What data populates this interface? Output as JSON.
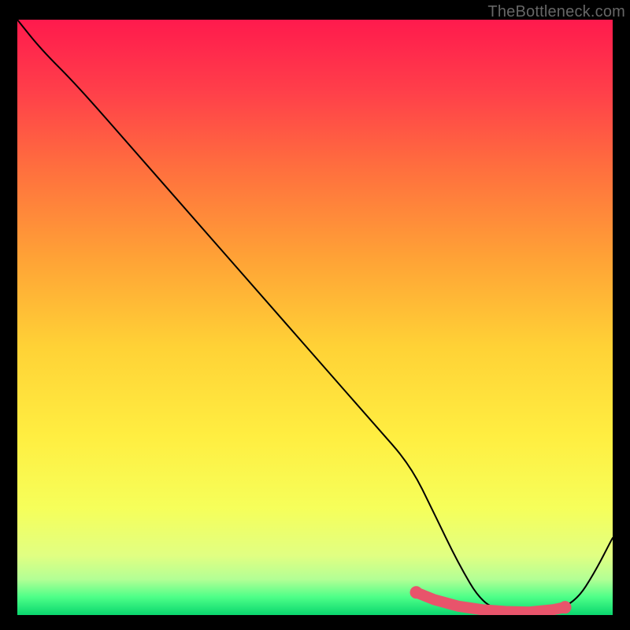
{
  "watermark": "TheBottleneck.com",
  "chart_data": {
    "type": "line",
    "title": "",
    "xlabel": "",
    "ylabel": "",
    "xlim": [
      0,
      100
    ],
    "ylim": [
      0,
      100
    ],
    "x": [
      0,
      4,
      10,
      20,
      30,
      40,
      50,
      60,
      66,
      70,
      74,
      78,
      82,
      86,
      90,
      94,
      97,
      100
    ],
    "values": [
      100,
      95,
      89,
      77.6,
      66.2,
      54.8,
      43.4,
      32.0,
      25.2,
      17.1,
      8.8,
      2.0,
      0.6,
      0.4,
      0.5,
      2.5,
      7.2,
      13.0
    ],
    "highlight_band": {
      "x": [
        67,
        70,
        74,
        78,
        82,
        86,
        90,
        92
      ],
      "values": [
        3.8,
        2.6,
        1.5,
        0.9,
        0.6,
        0.5,
        0.9,
        1.3
      ]
    },
    "gradient_stops": [
      {
        "offset": 0.0,
        "color": "#ff1a4d"
      },
      {
        "offset": 0.12,
        "color": "#ff3f4a"
      },
      {
        "offset": 0.25,
        "color": "#ff6f3e"
      },
      {
        "offset": 0.4,
        "color": "#ffa236"
      },
      {
        "offset": 0.55,
        "color": "#ffd236"
      },
      {
        "offset": 0.7,
        "color": "#ffee41"
      },
      {
        "offset": 0.82,
        "color": "#f6ff5a"
      },
      {
        "offset": 0.9,
        "color": "#e1ff82"
      },
      {
        "offset": 0.94,
        "color": "#b3ff95"
      },
      {
        "offset": 0.97,
        "color": "#4dff88"
      },
      {
        "offset": 1.0,
        "color": "#0ad66e"
      }
    ]
  }
}
